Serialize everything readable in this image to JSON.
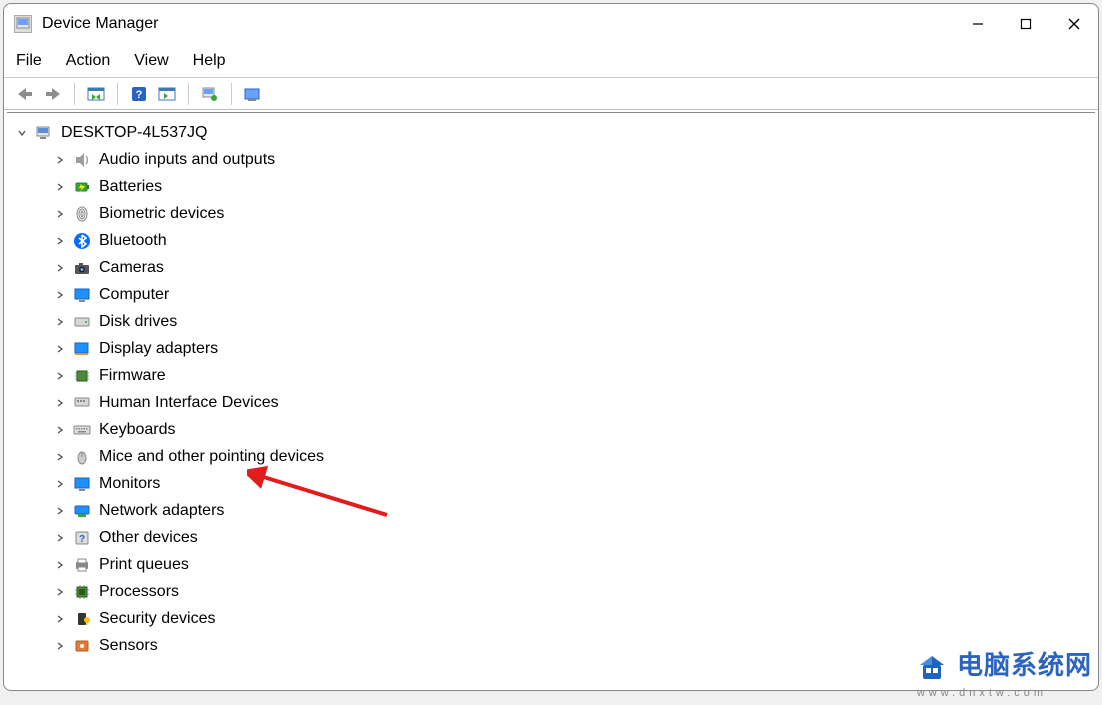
{
  "window": {
    "title": "Device Manager"
  },
  "menu": {
    "file": "File",
    "action": "Action",
    "view": "View",
    "help": "Help"
  },
  "tree": {
    "root": "DESKTOP-4L537JQ",
    "items": [
      "Audio inputs and outputs",
      "Batteries",
      "Biometric devices",
      "Bluetooth",
      "Cameras",
      "Computer",
      "Disk drives",
      "Display adapters",
      "Firmware",
      "Human Interface Devices",
      "Keyboards",
      "Mice and other pointing devices",
      "Monitors",
      "Network adapters",
      "Other devices",
      "Print queues",
      "Processors",
      "Security devices",
      "Sensors"
    ]
  },
  "watermark": {
    "text": "电脑系统网",
    "url": "www.dnxtw.com"
  }
}
